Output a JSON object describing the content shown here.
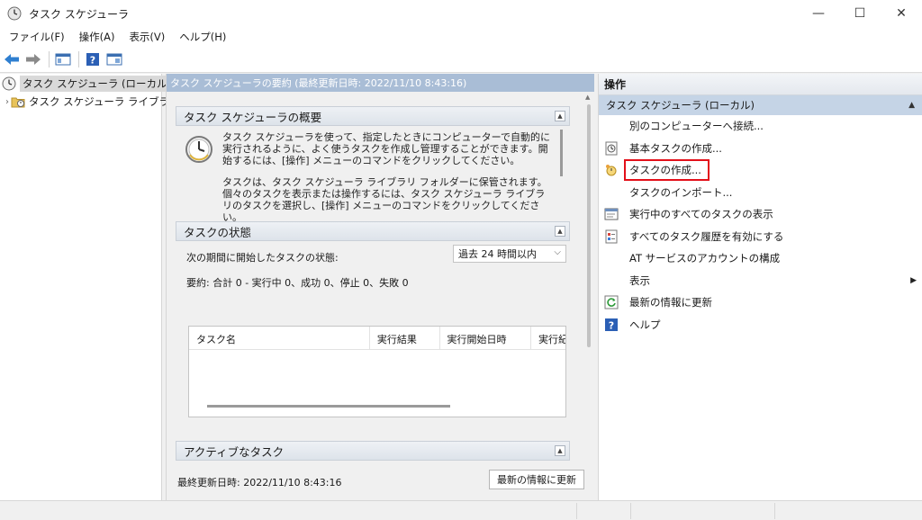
{
  "window": {
    "title": "タスク スケジューラ",
    "icon": "clock-icon",
    "minimize": "—",
    "maximize": "☐",
    "close": "✕"
  },
  "menu": [
    {
      "label": "ファイル(F)"
    },
    {
      "label": "操作(A)"
    },
    {
      "label": "表示(V)"
    },
    {
      "label": "ヘルプ(H)"
    }
  ],
  "toolbar": {
    "icons": [
      "back-arrow-icon",
      "forward-arrow-icon",
      "console-tree-icon",
      "help-icon",
      "show-action-pane-icon"
    ]
  },
  "tree": {
    "root_label": "タスク スケジューラ (ローカル)",
    "child_label": "タスク スケジューラ ライブラリ",
    "expander": "›"
  },
  "center": {
    "header": "タスク スケジューラの要約 (最終更新日時: 2022/11/10 8:43:16)",
    "overview": {
      "title": "タスク スケジューラの概要",
      "para1": "タスク スケジューラを使って、指定したときにコンピューターで自動的に実行されるように、よく使うタスクを作成し管理することができます。開始するには、[操作] メニューのコマンドをクリックしてください。",
      "para2": "タスクは、タスク スケジューラ ライブラリ フォルダーに保管されます。個々のタスクを表示または操作するには、タスク スケジューラ ライブラリのタスクを選択し、[操作] メニューのコマンドをクリックしてください。"
    },
    "status": {
      "title": "タスクの状態",
      "period_label": "次の期間に開始したタスクの状態:",
      "period_value": "過去 24 時間以内",
      "summary": "要約: 合計 0 - 実行中 0、成功 0、停止 0、失敗 0",
      "columns": [
        "タスク名",
        "実行結果",
        "実行開始日時",
        "実行紀"
      ]
    },
    "active": {
      "title": "アクティブなタスク"
    },
    "footer": {
      "last_update": "最終更新日時: 2022/11/10 8:43:16",
      "refresh_button": "最新の情報に更新"
    }
  },
  "actions": {
    "title": "操作",
    "group": "タスク スケジューラ (ローカル)",
    "items": [
      {
        "label": "別のコンピューターへ接続...",
        "icon": ""
      },
      {
        "label": "基本タスクの作成...",
        "icon": "basic-task-icon"
      },
      {
        "label": "タスクの作成...",
        "icon": "create-task-icon",
        "highlighted": true
      },
      {
        "label": "タスクのインポート...",
        "icon": ""
      },
      {
        "label": "実行中のすべてのタスクの表示",
        "icon": "running-tasks-icon"
      },
      {
        "label": "すべてのタスク履歴を有効にする",
        "icon": "task-history-icon"
      },
      {
        "label": "AT サービスのアカウントの構成",
        "icon": ""
      },
      {
        "label": "表示",
        "icon": "",
        "submenu": true
      },
      {
        "label": "最新の情報に更新",
        "icon": "refresh-icon"
      },
      {
        "label": "ヘルプ",
        "icon": "help-icon"
      }
    ]
  },
  "colors": {
    "accent_header": "#a9bdd6",
    "group_bg": "#c5d4e6",
    "highlight_border": "#e3101a"
  }
}
